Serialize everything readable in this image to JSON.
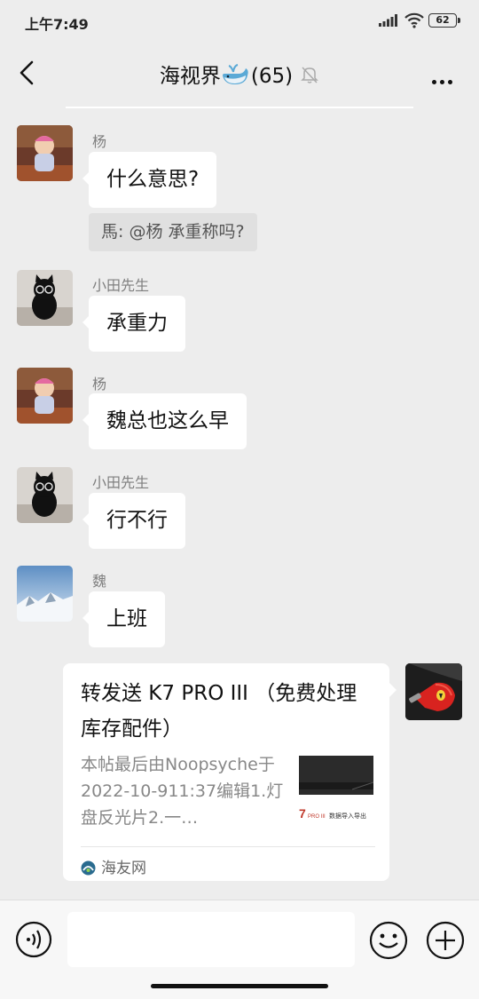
{
  "status_bar": {
    "time": "上午7:49",
    "battery": "62"
  },
  "header": {
    "title": "海视界",
    "member_count": "(65)"
  },
  "messages": [
    {
      "sender": "杨",
      "text": "什么意思?"
    },
    {
      "quote": "馬: @杨  承重称吗?"
    },
    {
      "sender": "小田先生",
      "text": "承重力"
    },
    {
      "sender": "杨",
      "text": "魏总也这么早"
    },
    {
      "sender": "小田先生",
      "text": "行不行"
    },
    {
      "sender": "魏",
      "text": "上班"
    }
  ],
  "shared_card": {
    "title": "转发送 K7 PRO III （免费处理库存配件）",
    "description": "本帖最后由Noopsyche于2022-10-911:37编辑1.灯盘反光片2.一…",
    "source": "海友网",
    "thumb_text_1": "7",
    "thumb_text_2": "PRO III",
    "thumb_text_3": "数据导入导出"
  },
  "colors": {
    "background": "#ededed",
    "bubble": "#ffffff",
    "accent": "#f2b233"
  }
}
